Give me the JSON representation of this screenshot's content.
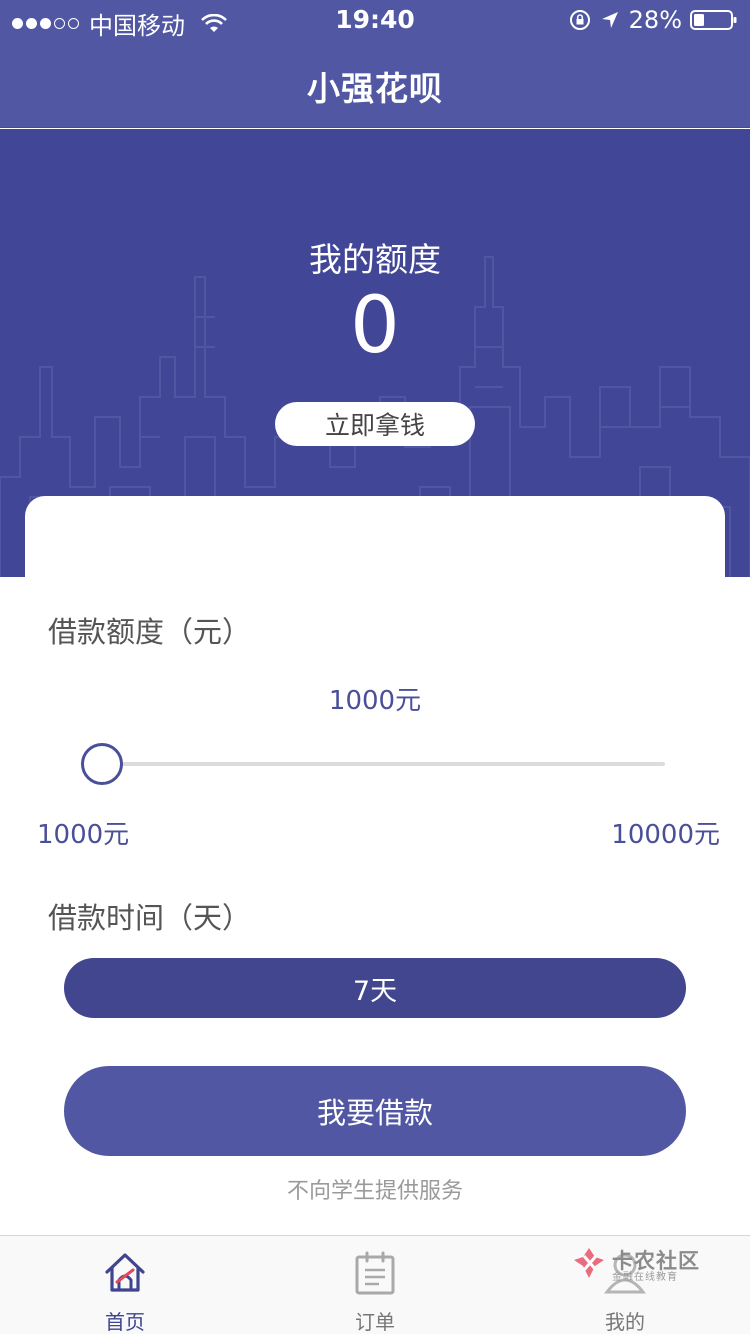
{
  "status_bar": {
    "carrier": "中国移动",
    "time": "19:40",
    "battery": "28%"
  },
  "nav": {
    "title": "小强花呗"
  },
  "hero": {
    "quota_label": "我的额度",
    "quota_value": "0",
    "get_money_label": "立即拿钱"
  },
  "loan_form": {
    "amount_label": "借款额度（元）",
    "current_amount": "1000元",
    "min_amount": "1000元",
    "max_amount": "10000元",
    "slider_fraction": 0,
    "time_label": "借款时间（天）",
    "term_option": "7天",
    "borrow_button": "我要借款",
    "notice": "不向学生提供服务"
  },
  "tab_bar": {
    "items": [
      {
        "label": "首页",
        "icon": "home-icon",
        "active": true
      },
      {
        "label": "订单",
        "icon": "order-icon",
        "active": false
      },
      {
        "label": "我的",
        "icon": "profile-icon",
        "active": false
      }
    ]
  },
  "watermark": {
    "title": "卡农社区",
    "subtitle": "金融在线教育"
  },
  "colors": {
    "primary": "#5157a3",
    "hero_bg": "#414697",
    "accent_text": "#4a4f9a"
  }
}
